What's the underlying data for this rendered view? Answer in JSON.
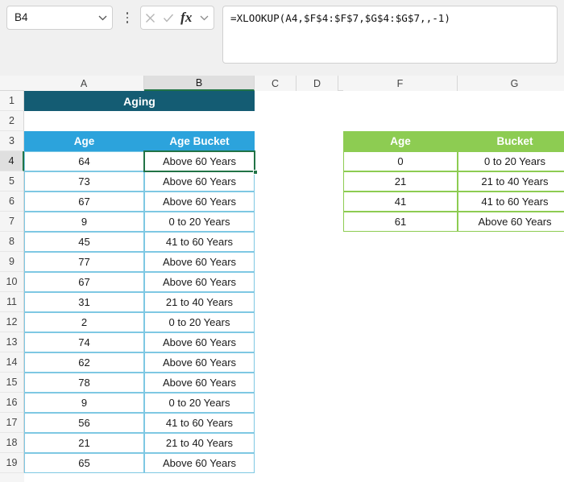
{
  "formula_bar": {
    "name_box_value": "B4",
    "formula": "=XLOOKUP(A4,$F$4:$F$7,$G$4:$G$7,,-1)",
    "cancel_icon": "close-icon",
    "enter_icon": "check-icon",
    "function_icon": "fx",
    "menu_icon": "more-vertical-icon",
    "chevron_icon": "chevron-down-icon"
  },
  "grid": {
    "column_headers": [
      "A",
      "B",
      "C",
      "D",
      "F",
      "G"
    ],
    "selected_column": "B",
    "row_headers": [
      "1",
      "2",
      "3",
      "4",
      "5",
      "6",
      "7",
      "8",
      "9",
      "10",
      "11",
      "12",
      "13",
      "14",
      "15",
      "16",
      "17",
      "18",
      "19"
    ],
    "selected_row": "4",
    "selected_cell": "B4"
  },
  "title_banner": {
    "text": "Aging",
    "bg_color": "#145c73",
    "text_color": "#ffffff"
  },
  "left_table": {
    "header_color": "#2ca3dc",
    "border_color": "#7ec8e3",
    "headers": [
      "Age",
      "Age Bucket"
    ],
    "rows": [
      {
        "row": "4",
        "age": "64",
        "bucket": "Above 60 Years"
      },
      {
        "row": "5",
        "age": "73",
        "bucket": "Above 60 Years"
      },
      {
        "row": "6",
        "age": "67",
        "bucket": "Above 60 Years"
      },
      {
        "row": "7",
        "age": "9",
        "bucket": "0 to 20 Years"
      },
      {
        "row": "8",
        "age": "45",
        "bucket": "41 to 60 Years"
      },
      {
        "row": "9",
        "age": "77",
        "bucket": "Above 60 Years"
      },
      {
        "row": "10",
        "age": "67",
        "bucket": "Above 60 Years"
      },
      {
        "row": "11",
        "age": "31",
        "bucket": "21 to 40 Years"
      },
      {
        "row": "12",
        "age": "2",
        "bucket": "0 to 20 Years"
      },
      {
        "row": "13",
        "age": "74",
        "bucket": "Above 60 Years"
      },
      {
        "row": "14",
        "age": "62",
        "bucket": "Above 60 Years"
      },
      {
        "row": "15",
        "age": "78",
        "bucket": "Above 60 Years"
      },
      {
        "row": "16",
        "age": "9",
        "bucket": "0 to 20 Years"
      },
      {
        "row": "17",
        "age": "56",
        "bucket": "41 to 60 Years"
      },
      {
        "row": "18",
        "age": "21",
        "bucket": "21 to 40 Years"
      },
      {
        "row": "19",
        "age": "65",
        "bucket": "Above 60 Years"
      }
    ]
  },
  "lookup_table": {
    "header_color": "#8dcc52",
    "border_color": "#8dcc52",
    "headers": [
      "Age",
      "Bucket"
    ],
    "rows": [
      {
        "row": "4",
        "age": "0",
        "bucket": "0 to 20 Years"
      },
      {
        "row": "5",
        "age": "21",
        "bucket": "21 to 40 Years"
      },
      {
        "row": "6",
        "age": "41",
        "bucket": "41 to 60 Years"
      },
      {
        "row": "7",
        "age": "61",
        "bucket": "Above 60 Years"
      }
    ]
  }
}
